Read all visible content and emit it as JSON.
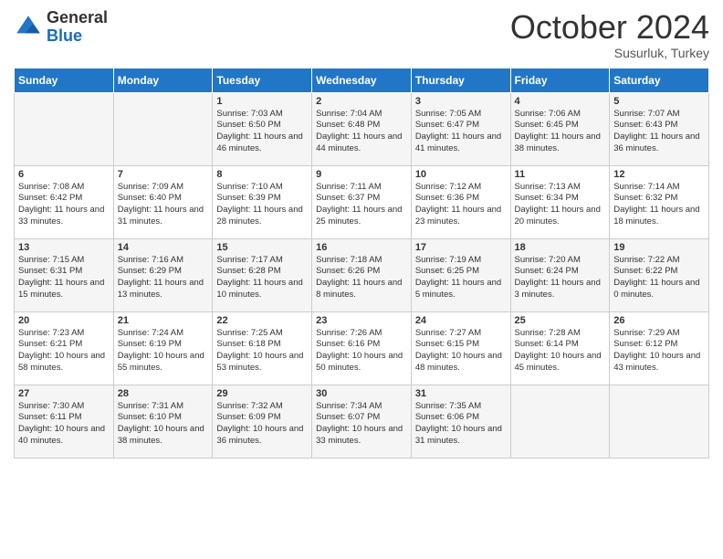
{
  "logo": {
    "general": "General",
    "blue": "Blue"
  },
  "header": {
    "month": "October 2024",
    "location": "Susurluk, Turkey"
  },
  "days_of_week": [
    "Sunday",
    "Monday",
    "Tuesday",
    "Wednesday",
    "Thursday",
    "Friday",
    "Saturday"
  ],
  "weeks": [
    [
      {
        "day": "",
        "content": ""
      },
      {
        "day": "",
        "content": ""
      },
      {
        "day": "1",
        "content": "Sunrise: 7:03 AM\nSunset: 6:50 PM\nDaylight: 11 hours and 46 minutes."
      },
      {
        "day": "2",
        "content": "Sunrise: 7:04 AM\nSunset: 6:48 PM\nDaylight: 11 hours and 44 minutes."
      },
      {
        "day": "3",
        "content": "Sunrise: 7:05 AM\nSunset: 6:47 PM\nDaylight: 11 hours and 41 minutes."
      },
      {
        "day": "4",
        "content": "Sunrise: 7:06 AM\nSunset: 6:45 PM\nDaylight: 11 hours and 38 minutes."
      },
      {
        "day": "5",
        "content": "Sunrise: 7:07 AM\nSunset: 6:43 PM\nDaylight: 11 hours and 36 minutes."
      }
    ],
    [
      {
        "day": "6",
        "content": "Sunrise: 7:08 AM\nSunset: 6:42 PM\nDaylight: 11 hours and 33 minutes."
      },
      {
        "day": "7",
        "content": "Sunrise: 7:09 AM\nSunset: 6:40 PM\nDaylight: 11 hours and 31 minutes."
      },
      {
        "day": "8",
        "content": "Sunrise: 7:10 AM\nSunset: 6:39 PM\nDaylight: 11 hours and 28 minutes."
      },
      {
        "day": "9",
        "content": "Sunrise: 7:11 AM\nSunset: 6:37 PM\nDaylight: 11 hours and 25 minutes."
      },
      {
        "day": "10",
        "content": "Sunrise: 7:12 AM\nSunset: 6:36 PM\nDaylight: 11 hours and 23 minutes."
      },
      {
        "day": "11",
        "content": "Sunrise: 7:13 AM\nSunset: 6:34 PM\nDaylight: 11 hours and 20 minutes."
      },
      {
        "day": "12",
        "content": "Sunrise: 7:14 AM\nSunset: 6:32 PM\nDaylight: 11 hours and 18 minutes."
      }
    ],
    [
      {
        "day": "13",
        "content": "Sunrise: 7:15 AM\nSunset: 6:31 PM\nDaylight: 11 hours and 15 minutes."
      },
      {
        "day": "14",
        "content": "Sunrise: 7:16 AM\nSunset: 6:29 PM\nDaylight: 11 hours and 13 minutes."
      },
      {
        "day": "15",
        "content": "Sunrise: 7:17 AM\nSunset: 6:28 PM\nDaylight: 11 hours and 10 minutes."
      },
      {
        "day": "16",
        "content": "Sunrise: 7:18 AM\nSunset: 6:26 PM\nDaylight: 11 hours and 8 minutes."
      },
      {
        "day": "17",
        "content": "Sunrise: 7:19 AM\nSunset: 6:25 PM\nDaylight: 11 hours and 5 minutes."
      },
      {
        "day": "18",
        "content": "Sunrise: 7:20 AM\nSunset: 6:24 PM\nDaylight: 11 hours and 3 minutes."
      },
      {
        "day": "19",
        "content": "Sunrise: 7:22 AM\nSunset: 6:22 PM\nDaylight: 11 hours and 0 minutes."
      }
    ],
    [
      {
        "day": "20",
        "content": "Sunrise: 7:23 AM\nSunset: 6:21 PM\nDaylight: 10 hours and 58 minutes."
      },
      {
        "day": "21",
        "content": "Sunrise: 7:24 AM\nSunset: 6:19 PM\nDaylight: 10 hours and 55 minutes."
      },
      {
        "day": "22",
        "content": "Sunrise: 7:25 AM\nSunset: 6:18 PM\nDaylight: 10 hours and 53 minutes."
      },
      {
        "day": "23",
        "content": "Sunrise: 7:26 AM\nSunset: 6:16 PM\nDaylight: 10 hours and 50 minutes."
      },
      {
        "day": "24",
        "content": "Sunrise: 7:27 AM\nSunset: 6:15 PM\nDaylight: 10 hours and 48 minutes."
      },
      {
        "day": "25",
        "content": "Sunrise: 7:28 AM\nSunset: 6:14 PM\nDaylight: 10 hours and 45 minutes."
      },
      {
        "day": "26",
        "content": "Sunrise: 7:29 AM\nSunset: 6:12 PM\nDaylight: 10 hours and 43 minutes."
      }
    ],
    [
      {
        "day": "27",
        "content": "Sunrise: 7:30 AM\nSunset: 6:11 PM\nDaylight: 10 hours and 40 minutes."
      },
      {
        "day": "28",
        "content": "Sunrise: 7:31 AM\nSunset: 6:10 PM\nDaylight: 10 hours and 38 minutes."
      },
      {
        "day": "29",
        "content": "Sunrise: 7:32 AM\nSunset: 6:09 PM\nDaylight: 10 hours and 36 minutes."
      },
      {
        "day": "30",
        "content": "Sunrise: 7:34 AM\nSunset: 6:07 PM\nDaylight: 10 hours and 33 minutes."
      },
      {
        "day": "31",
        "content": "Sunrise: 7:35 AM\nSunset: 6:06 PM\nDaylight: 10 hours and 31 minutes."
      },
      {
        "day": "",
        "content": ""
      },
      {
        "day": "",
        "content": ""
      }
    ]
  ]
}
